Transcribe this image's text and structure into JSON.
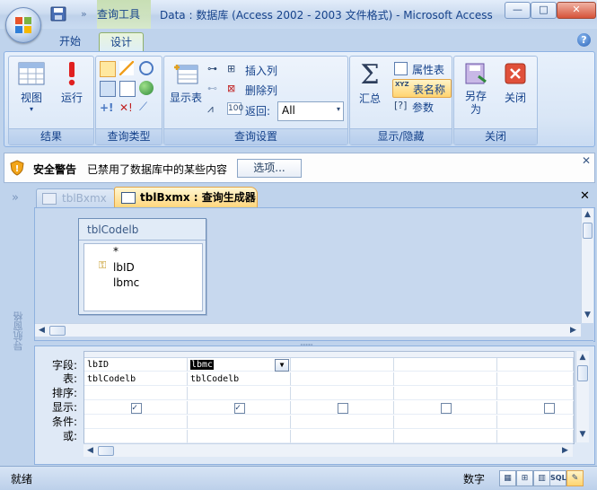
{
  "window": {
    "context_tool": "查询工具",
    "title": "Data : 数据库 (Access 2002 - 2003 文件格式) - Microsoft Access",
    "minimize": "—",
    "maximize": "□",
    "close": "✕"
  },
  "tabs": [
    {
      "label": "开始"
    },
    {
      "label": "设计"
    }
  ],
  "ribbon": {
    "results": {
      "label": "结果",
      "view": "视图",
      "run": "运行"
    },
    "query_type": {
      "label": "查询类型"
    },
    "query_setup": {
      "label": "查询设置",
      "show_table": "显示表",
      "insert_rows": "插入列",
      "delete_rows": "删除列",
      "return_label": "返回:",
      "return_value": "All"
    },
    "show_hide": {
      "label": "显示/隐藏",
      "totals": "汇总",
      "property_sheet": "属性表",
      "table_names": "表名称",
      "parameters": "参数"
    },
    "close_group": {
      "label": "关闭",
      "save_as": "另存为",
      "close": "关闭"
    }
  },
  "security": {
    "title": "安全警告",
    "message": "已禁用了数据库中的某些内容",
    "options_button": "选项...",
    "close": "✕"
  },
  "doc_tabs": [
    {
      "label": "tblBxmx"
    },
    {
      "label": "tblBxmx : 查询生成器"
    }
  ],
  "nav_pane": {
    "label": "导航窗格",
    "toggle": "»"
  },
  "table_box": {
    "title": "tblCodelb",
    "fields": [
      "*",
      "lbID",
      "lbmc"
    ]
  },
  "grid": {
    "row_labels": [
      "字段:",
      "表:",
      "排序:",
      "显示:",
      "条件:",
      "或:"
    ],
    "columns": [
      {
        "field": "lbID",
        "table": "tblCodelb",
        "show": true
      },
      {
        "field": "lbmc",
        "table": "tblCodelb",
        "show": true
      },
      {
        "field": "",
        "table": "",
        "show": false
      },
      {
        "field": "",
        "table": "",
        "show": false
      },
      {
        "field": "",
        "table": "",
        "show": false
      }
    ]
  },
  "status": {
    "left": "就绪",
    "mode": "数字",
    "views": [
      "数据表视图",
      "数据透视表",
      "数据透视图",
      "SQL",
      "设计视图"
    ],
    "sql_label": "SQL"
  },
  "colors": {
    "accent": "#15428b",
    "ribbon_bg": "#dde9f8",
    "active_doc_tab": "#ffd67d",
    "contextual": "#c3dca8"
  }
}
